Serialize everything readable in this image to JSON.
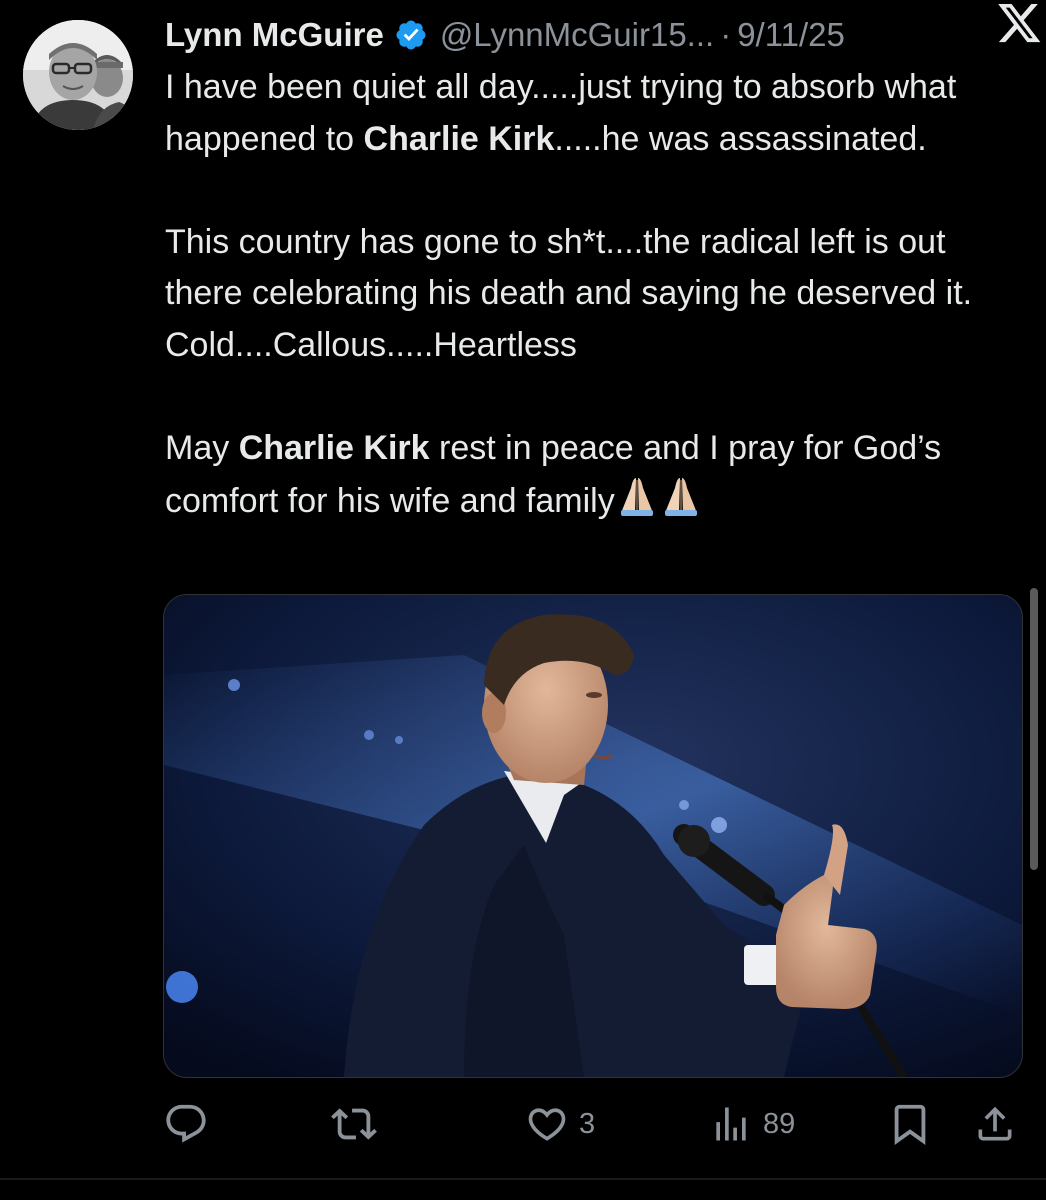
{
  "post": {
    "author": {
      "display_name": "Lynn McGuire",
      "handle": "@LynnMcGuir15...",
      "verified": true
    },
    "separator": "·",
    "date": "9/11/25",
    "platform_logo": "x-logo-icon",
    "text": {
      "p1_a": "I have been quiet all day.....just trying to absorb what happened to ",
      "p1_mention": "Charlie Kirk",
      "p1_b": ".....he was assassinated.",
      "p2": "This country has gone to sh*t....the radical left is out there celebrating his death and saying he deserved it.  Cold....Callous.....Heartless",
      "p3_a": "May ",
      "p3_mention": "Charlie Kirk",
      "p3_b": " rest in peace and I pray for God’s comfort for his wife and family"
    },
    "emojis": [
      "folded-hands-icon",
      "folded-hands-icon"
    ],
    "media": {
      "type": "photo",
      "subject": "man in dark suit speaking into microphone giving thumbs up"
    }
  },
  "actions": {
    "reply": {
      "icon": "reply-icon",
      "count": ""
    },
    "repost": {
      "icon": "repost-icon",
      "count": ""
    },
    "like": {
      "icon": "heart-icon",
      "count": "3"
    },
    "views": {
      "icon": "views-icon",
      "count": "89"
    },
    "bookmark": {
      "icon": "bookmark-icon"
    },
    "share": {
      "icon": "share-icon"
    }
  },
  "colors": {
    "background": "#000000",
    "text_primary": "#e7e9ea",
    "text_secondary": "#8b9299",
    "verified_badge": "#1d9bf0"
  }
}
